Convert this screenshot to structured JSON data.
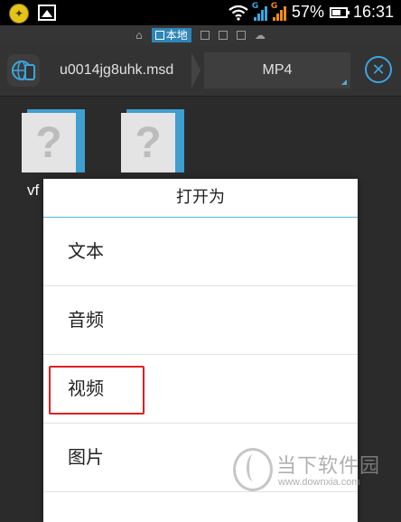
{
  "status_bar": {
    "battery_percent": "57%",
    "time": "16:31",
    "network_label_1": "G",
    "network_label_2": "G"
  },
  "location_bar": {
    "items": [
      {
        "label": "",
        "icon": "home-icon"
      },
      {
        "label": "本地",
        "icon": "phone-icon",
        "active": true
      },
      {
        "label": "",
        "icon": "phone-icon"
      },
      {
        "label": "",
        "icon": "tablet-icon"
      },
      {
        "label": "",
        "icon": "computer-icon"
      },
      {
        "label": "",
        "icon": "cloud-icon"
      }
    ]
  },
  "toolbar": {
    "path_segment": "u0014jg8uhk.msd",
    "current_segment": "MP4",
    "accent_color": "#3aa6e0"
  },
  "files": {
    "tiles": [
      {
        "icon": "unknown-file-icon",
        "glyph": "?"
      },
      {
        "icon": "unknown-file-icon",
        "glyph": "?"
      }
    ],
    "visible_name": "vf"
  },
  "dialog": {
    "title": "打开为",
    "options": [
      {
        "label": "文本"
      },
      {
        "label": "音频"
      },
      {
        "label": "视频",
        "highlighted": true
      },
      {
        "label": "图片"
      }
    ],
    "highlight_color": "#e02020"
  },
  "watermark": {
    "name": "当下软件园",
    "url": "www.downxia.com"
  }
}
